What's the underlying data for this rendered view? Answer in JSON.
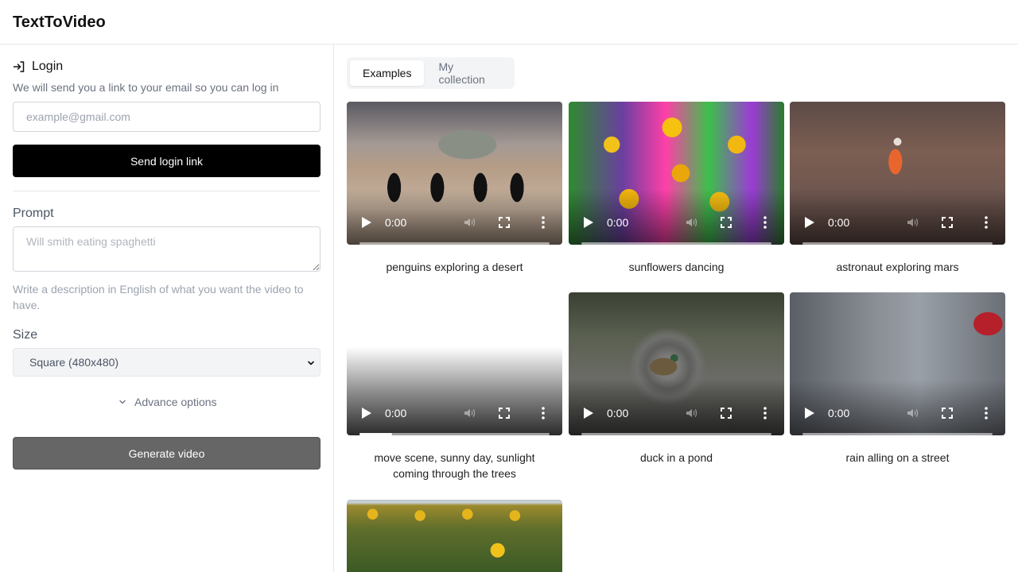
{
  "app": {
    "title": "TextToVideo"
  },
  "login": {
    "title": "Login",
    "description": "We will send you a link to your email so you can log in",
    "email_placeholder": "example@gmail.com",
    "email_value": "",
    "send_button": "Send login link"
  },
  "form": {
    "prompt_label": "Prompt",
    "prompt_placeholder": "Will smith eating spaghetti",
    "prompt_value": "",
    "prompt_help": "Write a description in English of what you want the video to have.",
    "size_label": "Size",
    "size_selected": "Square (480x480)",
    "advance_options": "Advance options",
    "generate_button": "Generate video"
  },
  "tabs": [
    {
      "label": "Examples",
      "active": true
    },
    {
      "label": "My collection",
      "active": false
    }
  ],
  "videos": [
    {
      "caption": "penguins exploring a desert",
      "time": "0:00",
      "progress": 0
    },
    {
      "caption": "sunflowers dancing",
      "time": "0:00",
      "progress": 0
    },
    {
      "caption": "astronaut exploring mars",
      "time": "0:00",
      "progress": 0
    },
    {
      "caption": "move scene, sunny day, sunlight coming through the trees",
      "time": "0:00",
      "progress": 0.17
    },
    {
      "caption": "duck in a pond",
      "time": "0:00",
      "progress": 0
    },
    {
      "caption": "rain alling on a street",
      "time": "0:00",
      "progress": 0
    },
    {
      "caption": "",
      "time": "",
      "progress": 0
    }
  ],
  "icons": {
    "login": "login-icon",
    "chevron": "chevron-down-icon",
    "play": "play-icon",
    "volume": "volume-icon",
    "fullscreen": "fullscreen-icon",
    "more": "more-vertical-icon"
  },
  "colors": {
    "primary_button": "#000000",
    "generate_button": "#666666",
    "border": "#e5e7eb",
    "muted_text": "#6b7280"
  }
}
